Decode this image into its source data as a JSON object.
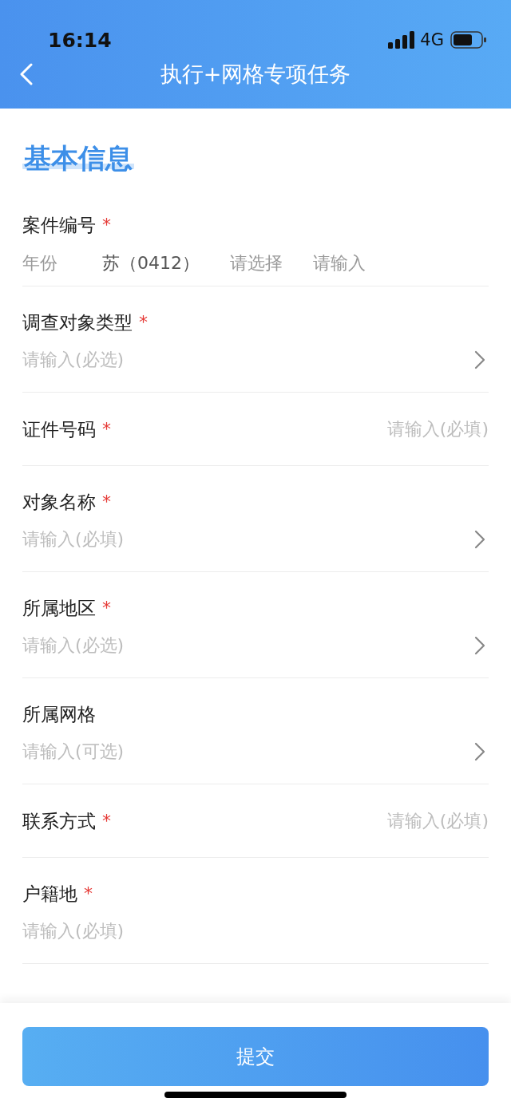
{
  "status_bar": {
    "time": "16:14",
    "network": "4G"
  },
  "nav": {
    "title": "执行+网格专项任务"
  },
  "section": {
    "title": "基本信息"
  },
  "fields": [
    {
      "kind": "segments",
      "label": "案件编号",
      "required_mark": "*",
      "parts": [
        {
          "text": "年份",
          "filled": false
        },
        {
          "text": "苏（0412）",
          "filled": true
        },
        {
          "text": "请选择",
          "filled": false
        },
        {
          "text": "请输入",
          "filled": false
        }
      ]
    },
    {
      "kind": "stacked",
      "label": "调查对象类型",
      "required_mark": "*",
      "placeholder": "请输入(必选)",
      "chevron": true
    },
    {
      "kind": "inline",
      "label": "证件号码",
      "required_mark": "*",
      "placeholder": "请输入(必填)"
    },
    {
      "kind": "stacked",
      "label": "对象名称",
      "required_mark": "*",
      "placeholder": "请输入(必填)",
      "chevron": true
    },
    {
      "kind": "stacked",
      "label": "所属地区",
      "required_mark": "*",
      "placeholder": "请输入(必选)",
      "chevron": true
    },
    {
      "kind": "stacked",
      "label": "所属网格",
      "placeholder": "请输入(可选)",
      "chevron": true
    },
    {
      "kind": "inline",
      "label": "联系方式",
      "required_mark": "*",
      "placeholder": "请输入(必填)"
    },
    {
      "kind": "stacked",
      "label": "户籍地",
      "required_mark": "*",
      "placeholder": "请输入(必填)",
      "chevron": false
    }
  ],
  "submit_button": {
    "label": "提交"
  }
}
